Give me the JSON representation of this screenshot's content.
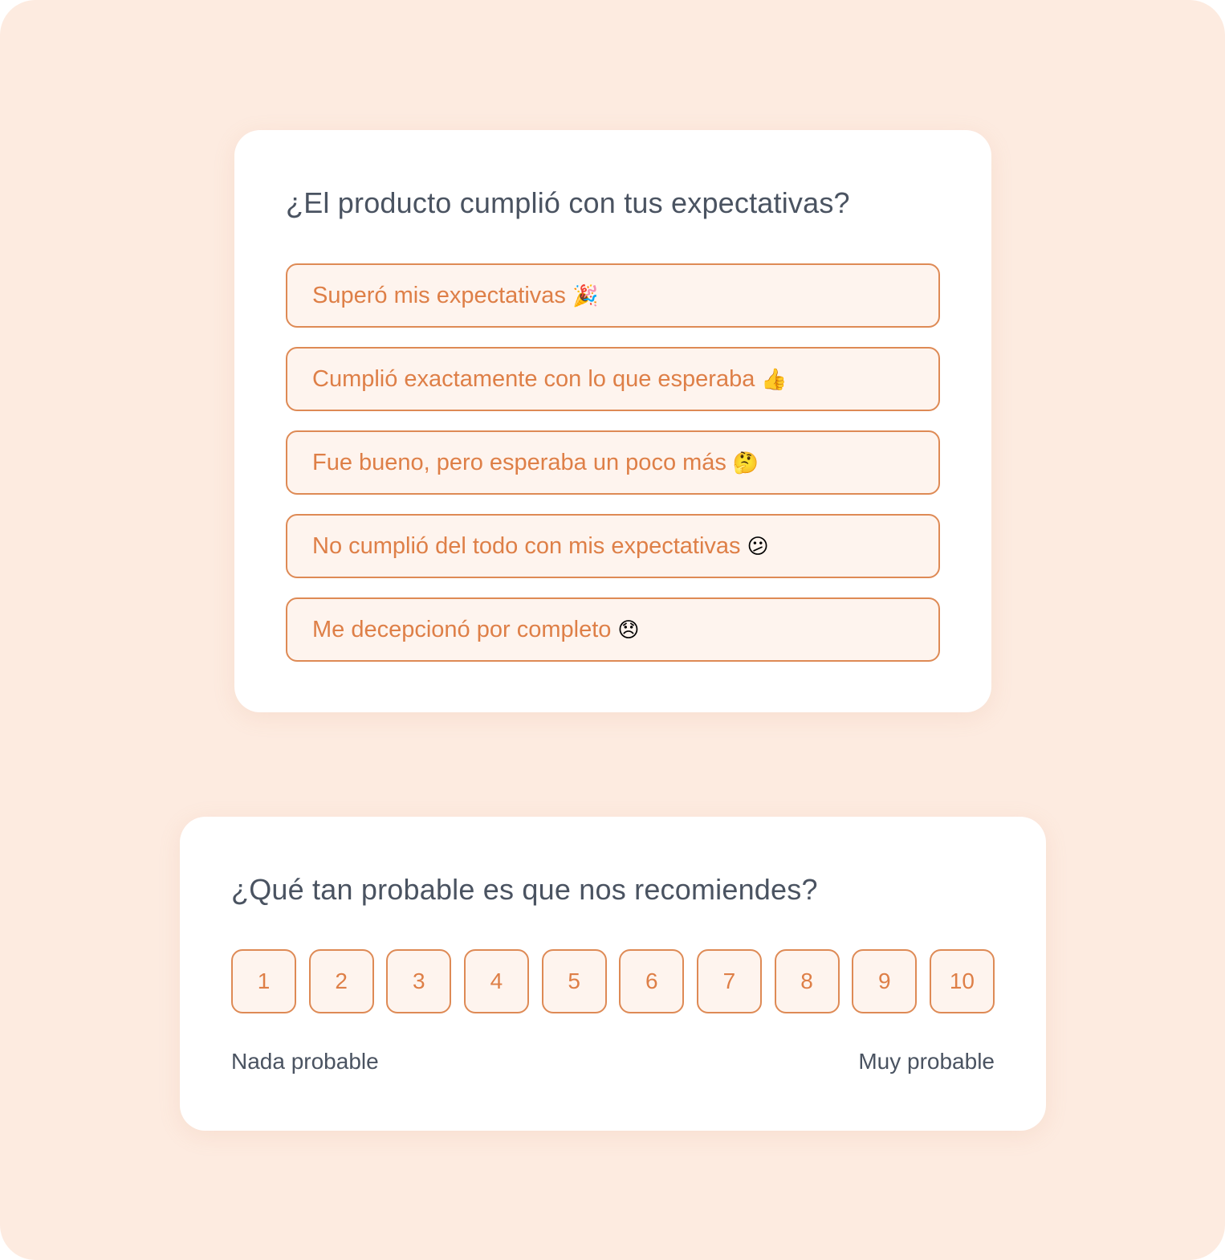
{
  "colors": {
    "background": "#fdebe0",
    "card": "#ffffff",
    "accent": "#de7f47",
    "option_fill": "#fef4ee",
    "text_dark": "#4a5361"
  },
  "survey_expectations": {
    "question": "¿El producto cumplió con tus expectativas?",
    "options": [
      {
        "label": "Superó mis expectativas",
        "emoji": "🎉",
        "icon": "party-popper-icon"
      },
      {
        "label": "Cumplió exactamente con lo que esperaba",
        "emoji": "👍",
        "icon": "thumbs-up-icon"
      },
      {
        "label": "Fue bueno, pero esperaba un poco más",
        "emoji": "🤔",
        "icon": "thinking-face-icon"
      },
      {
        "label": "No cumplió del todo con mis expectativas",
        "emoji": "😕",
        "icon": "confused-face-icon"
      },
      {
        "label": "Me decepcionó por completo",
        "emoji": "😞",
        "icon": "disappointed-face-icon"
      }
    ]
  },
  "survey_recommend": {
    "question": "¿Qué tan probable es que nos recomiendes?",
    "scale": [
      "1",
      "2",
      "3",
      "4",
      "5",
      "6",
      "7",
      "8",
      "9",
      "10"
    ],
    "low_label": "Nada probable",
    "high_label": "Muy probable"
  }
}
